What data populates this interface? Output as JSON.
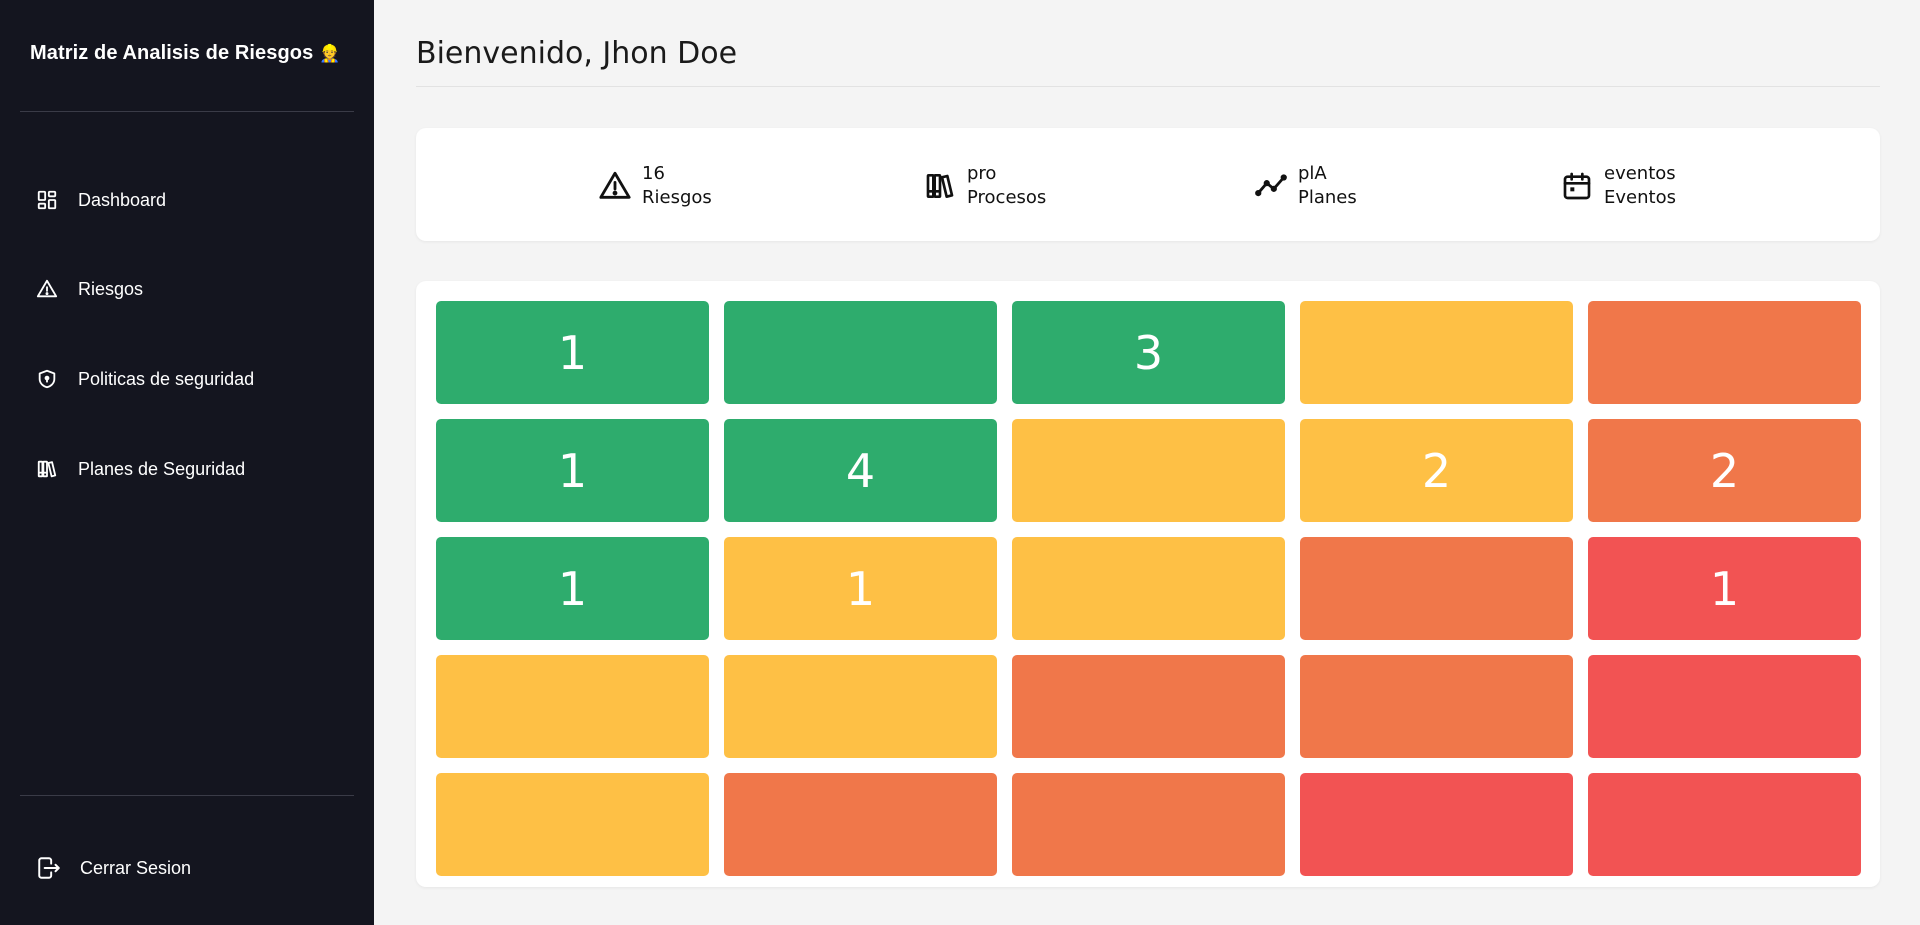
{
  "sidebar": {
    "brand": "Matriz de Analisis de Riesgos",
    "brand_emoji": "👷",
    "items": [
      {
        "label": "Dashboard",
        "icon": "dashboard-icon"
      },
      {
        "label": "Riesgos",
        "icon": "warning-icon"
      },
      {
        "label": "Politicas de seguridad",
        "icon": "shield-icon"
      },
      {
        "label": "Planes de Seguridad",
        "icon": "books-icon"
      }
    ],
    "logout": {
      "label": "Cerrar Sesion",
      "icon": "logout-icon"
    }
  },
  "header": {
    "welcome": "Bienvenido, Jhon Doe"
  },
  "stats": [
    {
      "value": "16",
      "label": "Riesgos",
      "icon": "warning-icon"
    },
    {
      "value": "pro",
      "label": "Procesos",
      "icon": "books-icon"
    },
    {
      "value": "plA",
      "label": "Planes",
      "icon": "trend-line-icon"
    },
    {
      "value": "eventos",
      "label": "Eventos",
      "icon": "calendar-icon"
    }
  ],
  "colors": {
    "green": "#2eac6d",
    "yellow": "#fec045",
    "orange": "#f0774a",
    "red": "#f25353",
    "sidebar_bg": "#14151f"
  },
  "matrix": {
    "rows": [
      [
        {
          "level": "green",
          "value": "1"
        },
        {
          "level": "green",
          "value": ""
        },
        {
          "level": "green",
          "value": "3"
        },
        {
          "level": "yellow",
          "value": ""
        },
        {
          "level": "orange",
          "value": ""
        }
      ],
      [
        {
          "level": "green",
          "value": "1"
        },
        {
          "level": "green",
          "value": "4"
        },
        {
          "level": "yellow",
          "value": ""
        },
        {
          "level": "yellow",
          "value": "2"
        },
        {
          "level": "orange",
          "value": "2"
        }
      ],
      [
        {
          "level": "green",
          "value": "1"
        },
        {
          "level": "yellow",
          "value": "1"
        },
        {
          "level": "yellow",
          "value": ""
        },
        {
          "level": "orange",
          "value": ""
        },
        {
          "level": "red",
          "value": "1"
        }
      ],
      [
        {
          "level": "yellow",
          "value": ""
        },
        {
          "level": "yellow",
          "value": ""
        },
        {
          "level": "orange",
          "value": ""
        },
        {
          "level": "orange",
          "value": ""
        },
        {
          "level": "red",
          "value": ""
        }
      ],
      [
        {
          "level": "yellow",
          "value": ""
        },
        {
          "level": "orange",
          "value": ""
        },
        {
          "level": "orange",
          "value": ""
        },
        {
          "level": "red",
          "value": ""
        },
        {
          "level": "red",
          "value": ""
        }
      ]
    ]
  }
}
